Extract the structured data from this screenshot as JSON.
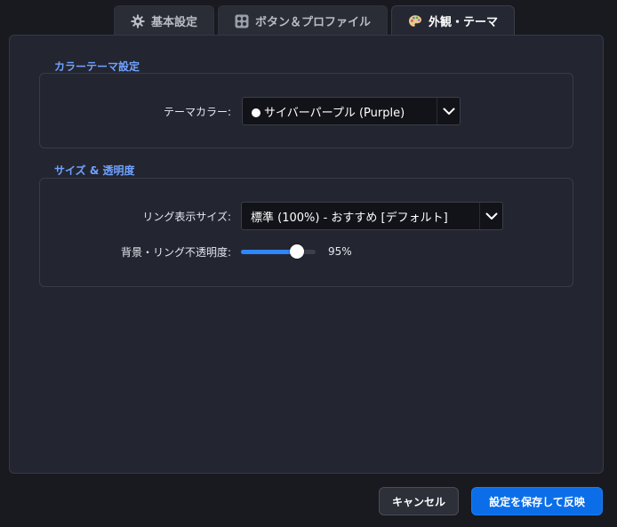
{
  "tabs": [
    {
      "id": "basic",
      "label": "基本設定",
      "icon": "gear-icon",
      "active": false
    },
    {
      "id": "buttons",
      "label": "ボタン＆プロファイル",
      "icon": "grid-buttons-icon",
      "active": false
    },
    {
      "id": "appearance",
      "label": "外観・テーマ",
      "icon": "palette-icon",
      "active": true
    }
  ],
  "color_theme": {
    "title": "カラーテーマ設定",
    "theme_color_label": "テーマカラー:",
    "theme_color_value": "サイバーパープル (Purple)"
  },
  "size_opacity": {
    "title": "サイズ & 透明度",
    "ring_size_label": "リング表示サイズ:",
    "ring_size_value": "標準 (100%) - おすすめ [デフォルト]",
    "opacity_label": "背景・リング不透明度:",
    "opacity_value": 95,
    "opacity_text": "95%"
  },
  "footer": {
    "cancel_label": "キャンセル",
    "save_label": "設定を保存して反映"
  },
  "colors": {
    "accent": "#0b6ee8",
    "section_title": "#6fa2ff",
    "slider_fill": "#2f86ff"
  }
}
